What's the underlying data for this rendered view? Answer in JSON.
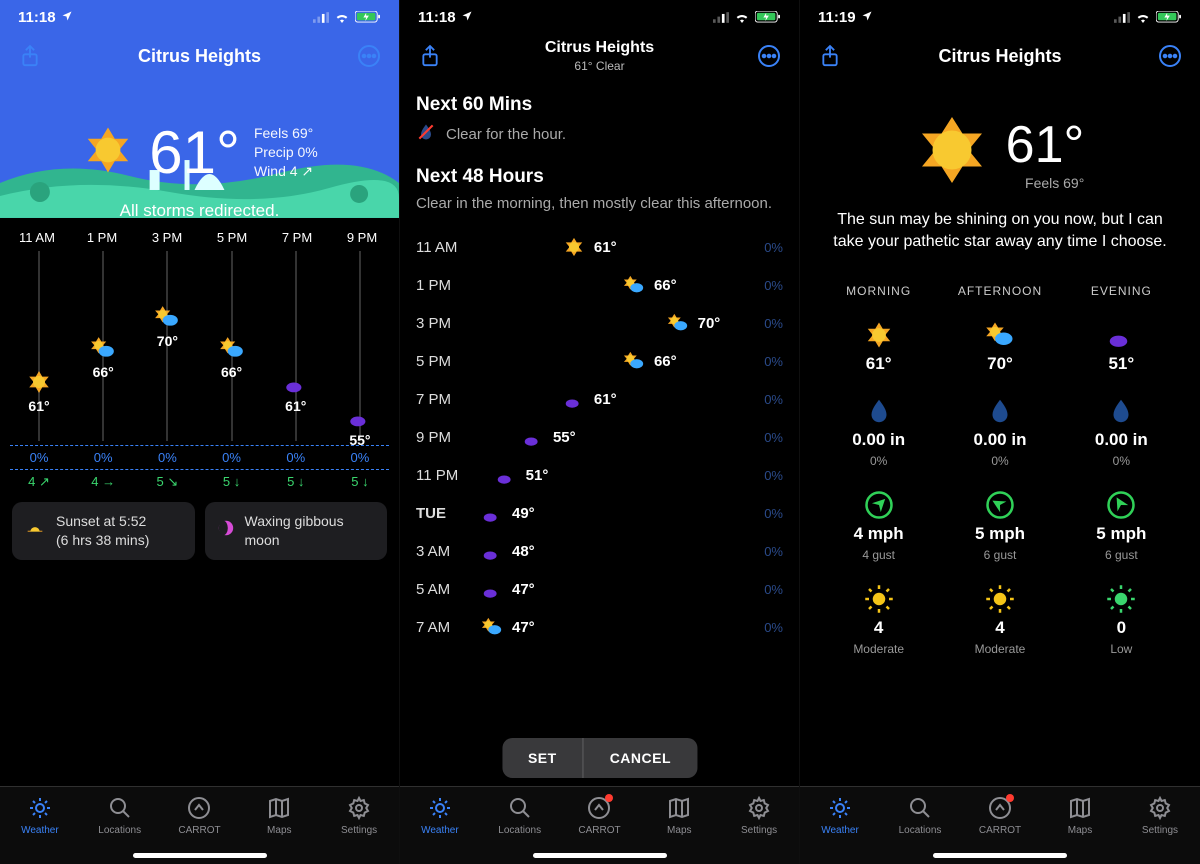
{
  "panels": [
    {
      "status_time": "11:18",
      "location": "Citrus Heights",
      "hero": {
        "temp": "61°",
        "feels": "Feels 69°",
        "precip": "Precip 0%",
        "wind": "Wind 4 ↗",
        "tagline": "All storms redirected."
      },
      "hourly": {
        "times": [
          "11 AM",
          "1 PM",
          "3 PM",
          "5 PM",
          "7 PM",
          "9 PM"
        ],
        "temps": [
          "61°",
          "66°",
          "70°",
          "66°",
          "61°",
          "55°"
        ],
        "icons": [
          "sun",
          "partly",
          "partly",
          "partly",
          "moon",
          "moon"
        ],
        "offsets_pct": [
          62,
          44,
          28,
          44,
          62,
          80
        ],
        "precip": [
          "0%",
          "0%",
          "0%",
          "0%",
          "0%",
          "0%"
        ],
        "wind": [
          "4 ↗",
          "4 →",
          "5 ↘",
          "5 ↓",
          "5 ↓",
          "5 ↓"
        ]
      },
      "cards": {
        "sunset_line1": "Sunset at 5:52",
        "sunset_line2": "(6 hrs 38 mins)",
        "moon": "Waxing gibbous moon"
      }
    },
    {
      "status_time": "11:18",
      "location": "Citrus Heights",
      "subtitle": "61° Clear",
      "next60_title": "Next 60 Mins",
      "next60_sub": "Clear for the hour.",
      "next48_title": "Next 48 Hours",
      "next48_sub": "Clear in the morning, then mostly clear this afternoon.",
      "rows": [
        {
          "time": "11 AM",
          "icon": "sun",
          "temp": "61°",
          "precip": "0%",
          "pos": 30
        },
        {
          "time": "1 PM",
          "icon": "partly",
          "temp": "66°",
          "precip": "0%",
          "pos": 52
        },
        {
          "time": "3 PM",
          "icon": "partly",
          "temp": "70°",
          "precip": "0%",
          "pos": 68
        },
        {
          "time": "5 PM",
          "icon": "partly",
          "temp": "66°",
          "precip": "0%",
          "pos": 52
        },
        {
          "time": "7 PM",
          "icon": "moon",
          "temp": "61°",
          "precip": "0%",
          "pos": 30
        },
        {
          "time": "9 PM",
          "icon": "moon",
          "temp": "55°",
          "precip": "0%",
          "pos": 15
        },
        {
          "time": "11 PM",
          "icon": "moon",
          "temp": "51°",
          "precip": "0%",
          "pos": 5
        },
        {
          "time": "TUE",
          "icon": "moon",
          "temp": "49°",
          "precip": "0%",
          "pos": 0,
          "day": true
        },
        {
          "time": "3 AM",
          "icon": "moon",
          "temp": "48°",
          "precip": "0%",
          "pos": 0
        },
        {
          "time": "5 AM",
          "icon": "moon",
          "temp": "47°",
          "precip": "0%",
          "pos": 0
        },
        {
          "time": "7 AM",
          "icon": "partly",
          "temp": "47°",
          "precip": "0%",
          "pos": 0
        }
      ],
      "overlay": {
        "set": "SET",
        "cancel": "CANCEL"
      }
    },
    {
      "status_time": "11:19",
      "location": "Citrus Heights",
      "hero": {
        "temp": "61°",
        "feels": "Feels 69°"
      },
      "tagline": "The sun may be shining on you now, but I can take your pathetic star away any time I choose.",
      "columns": [
        "MORNING",
        "AFTERNOON",
        "EVENING"
      ],
      "rows": {
        "temp": [
          {
            "icon": "sun",
            "val": "61°"
          },
          {
            "icon": "partly",
            "val": "70°"
          },
          {
            "icon": "moon",
            "val": "51°"
          }
        ],
        "precip": [
          {
            "val": "0.00 in",
            "sub": "0%"
          },
          {
            "val": "0.00 in",
            "sub": "0%"
          },
          {
            "val": "0.00 in",
            "sub": "0%"
          }
        ],
        "wind": [
          {
            "val": "4 mph",
            "sub": "4 gust",
            "dir": 45
          },
          {
            "val": "5 mph",
            "sub": "6 gust",
            "dir": -60
          },
          {
            "val": "5 mph",
            "sub": "6 gust",
            "dir": -30
          }
        ],
        "uv": [
          {
            "val": "4",
            "sub": "Moderate",
            "color": "#f5c518"
          },
          {
            "val": "4",
            "sub": "Moderate",
            "color": "#f5c518"
          },
          {
            "val": "0",
            "sub": "Low",
            "color": "#3ad66e"
          }
        ]
      }
    }
  ],
  "tabs": [
    "Weather",
    "Locations",
    "CARROT",
    "Maps",
    "Settings"
  ]
}
